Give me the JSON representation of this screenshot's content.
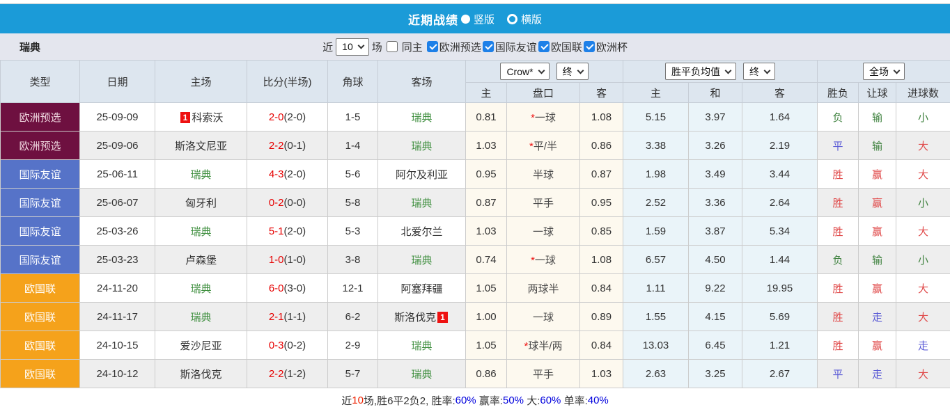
{
  "title_bar": {
    "title": "近期战绩",
    "vertical": {
      "label": "竖版",
      "selected": true
    },
    "horizontal": {
      "label": "横版",
      "selected": false
    }
  },
  "filter_bar": {
    "team": "瑞典",
    "near_label": "近",
    "count_value": "10",
    "matches_label": "场",
    "same_home": {
      "label": "同主",
      "checked": false
    },
    "leagues": [
      {
        "label": "欧洲预选",
        "checked": true
      },
      {
        "label": "国际友谊",
        "checked": true
      },
      {
        "label": "欧国联",
        "checked": true
      },
      {
        "label": "欧洲杯",
        "checked": true
      }
    ]
  },
  "table": {
    "headers": {
      "type": "类型",
      "date": "日期",
      "home": "主场",
      "score": "比分(半场)",
      "corner": "角球",
      "away": "客场",
      "odds_home": "主",
      "handicap": "盘口",
      "odds_away": "客",
      "avg_home": "主",
      "avg_draw": "和",
      "avg_away": "客",
      "result": "胜负",
      "let_goal": "让球",
      "goals": "进球数"
    },
    "selects": {
      "company": "Crow*",
      "company_time": "终",
      "avg": "胜平负均值",
      "avg_time": "终",
      "scope": "全场"
    },
    "highlight_team": "瑞典",
    "type_styles": {
      "欧洲预选": {
        "bg": "#6e1040",
        "fg": "#f0d8e0"
      },
      "国际友谊": {
        "bg": "#5673c8",
        "fg": "#ffffff"
      },
      "欧国联": {
        "bg": "#f5a21b",
        "fg": "#ffffff"
      }
    },
    "word_colors": {
      "胜": "word_red",
      "平": "word_blue",
      "负": "word_green",
      "赢": "word_red",
      "输": "word_green",
      "走": "word_blue",
      "大": "word_red",
      "小": "word_green"
    },
    "rows": [
      {
        "type": "欧洲预选",
        "date": "25-09-09",
        "home": {
          "badge_pre": "1",
          "name": "科索沃"
        },
        "score": {
          "ft": "2-0",
          "ht": "(2-0)"
        },
        "corner": "1-5",
        "away": {
          "name": "瑞典"
        },
        "odds": {
          "home": "0.81",
          "handicap": {
            "star": true,
            "text": "一球"
          },
          "away": "1.08"
        },
        "avg": {
          "home": "5.15",
          "draw": "3.97",
          "away": "1.64"
        },
        "result": "负",
        "let_goal": "输",
        "goals": "小"
      },
      {
        "type": "欧洲预选",
        "date": "25-09-06",
        "home": {
          "name": "斯洛文尼亚"
        },
        "score": {
          "ft": "2-2",
          "ht": "(0-1)"
        },
        "corner": "1-4",
        "away": {
          "name": "瑞典"
        },
        "odds": {
          "home": "1.03",
          "handicap": {
            "star": true,
            "text": "平/半"
          },
          "away": "0.86"
        },
        "avg": {
          "home": "3.38",
          "draw": "3.26",
          "away": "2.19"
        },
        "result": "平",
        "let_goal": "输",
        "goals": "大"
      },
      {
        "type": "国际友谊",
        "date": "25-06-11",
        "home": {
          "name": "瑞典"
        },
        "score": {
          "ft": "4-3",
          "ht": "(2-0)"
        },
        "corner": "5-6",
        "away": {
          "name": "阿尔及利亚"
        },
        "odds": {
          "home": "0.95",
          "handicap": {
            "star": false,
            "text": "半球"
          },
          "away": "0.87"
        },
        "avg": {
          "home": "1.98",
          "draw": "3.49",
          "away": "3.44"
        },
        "result": "胜",
        "let_goal": "赢",
        "goals": "大"
      },
      {
        "type": "国际友谊",
        "date": "25-06-07",
        "home": {
          "name": "匈牙利"
        },
        "score": {
          "ft": "0-2",
          "ht": "(0-0)"
        },
        "corner": "5-8",
        "away": {
          "name": "瑞典"
        },
        "odds": {
          "home": "0.87",
          "handicap": {
            "star": false,
            "text": "平手"
          },
          "away": "0.95"
        },
        "avg": {
          "home": "2.52",
          "draw": "3.36",
          "away": "2.64"
        },
        "result": "胜",
        "let_goal": "赢",
        "goals": "小"
      },
      {
        "type": "国际友谊",
        "date": "25-03-26",
        "home": {
          "name": "瑞典"
        },
        "score": {
          "ft": "5-1",
          "ht": "(2-0)"
        },
        "corner": "5-3",
        "away": {
          "name": "北爱尔兰"
        },
        "odds": {
          "home": "1.03",
          "handicap": {
            "star": false,
            "text": "一球"
          },
          "away": "0.85"
        },
        "avg": {
          "home": "1.59",
          "draw": "3.87",
          "away": "5.34"
        },
        "result": "胜",
        "let_goal": "赢",
        "goals": "大"
      },
      {
        "type": "国际友谊",
        "date": "25-03-23",
        "home": {
          "name": "卢森堡"
        },
        "score": {
          "ft": "1-0",
          "ht": "(1-0)"
        },
        "corner": "3-8",
        "away": {
          "name": "瑞典"
        },
        "odds": {
          "home": "0.74",
          "handicap": {
            "star": true,
            "text": "一球"
          },
          "away": "1.08"
        },
        "avg": {
          "home": "6.57",
          "draw": "4.50",
          "away": "1.44"
        },
        "result": "负",
        "let_goal": "输",
        "goals": "小"
      },
      {
        "type": "欧国联",
        "date": "24-11-20",
        "home": {
          "name": "瑞典"
        },
        "score": {
          "ft": "6-0",
          "ht": "(3-0)"
        },
        "corner": "12-1",
        "away": {
          "name": "阿塞拜疆"
        },
        "odds": {
          "home": "1.05",
          "handicap": {
            "star": false,
            "text": "两球半"
          },
          "away": "0.84"
        },
        "avg": {
          "home": "1.11",
          "draw": "9.22",
          "away": "19.95"
        },
        "result": "胜",
        "let_goal": "赢",
        "goals": "大"
      },
      {
        "type": "欧国联",
        "date": "24-11-17",
        "home": {
          "name": "瑞典"
        },
        "score": {
          "ft": "2-1",
          "ht": "(1-1)"
        },
        "corner": "6-2",
        "away": {
          "name": "斯洛伐克",
          "badge_post": "1"
        },
        "odds": {
          "home": "1.00",
          "handicap": {
            "star": false,
            "text": "一球"
          },
          "away": "0.89"
        },
        "avg": {
          "home": "1.55",
          "draw": "4.15",
          "away": "5.69"
        },
        "result": "胜",
        "let_goal": "走",
        "goals": "大"
      },
      {
        "type": "欧国联",
        "date": "24-10-15",
        "home": {
          "name": "爱沙尼亚"
        },
        "score": {
          "ft": "0-3",
          "ht": "(0-2)"
        },
        "corner": "2-9",
        "away": {
          "name": "瑞典"
        },
        "odds": {
          "home": "1.05",
          "handicap": {
            "star": true,
            "text": "球半/两"
          },
          "away": "0.84"
        },
        "avg": {
          "home": "13.03",
          "draw": "6.45",
          "away": "1.21"
        },
        "result": "胜",
        "let_goal": "赢",
        "goals": "走"
      },
      {
        "type": "欧国联",
        "date": "24-10-12",
        "home": {
          "name": "斯洛伐克"
        },
        "score": {
          "ft": "2-2",
          "ht": "(1-2)"
        },
        "corner": "5-7",
        "away": {
          "name": "瑞典"
        },
        "odds": {
          "home": "0.86",
          "handicap": {
            "star": false,
            "text": "平手"
          },
          "away": "1.03"
        },
        "avg": {
          "home": "2.63",
          "draw": "3.25",
          "away": "2.67"
        },
        "result": "平",
        "let_goal": "走",
        "goals": "大"
      }
    ]
  },
  "summary": {
    "segments": [
      {
        "t": "近",
        "c": "#333333"
      },
      {
        "t": "10",
        "c": "#ee2200"
      },
      {
        "t": "场,胜6平2负2, 胜率:",
        "c": "#333333"
      },
      {
        "t": "60%",
        "c": "#0000dd"
      },
      {
        "t": " 赢率:",
        "c": "#333333"
      },
      {
        "t": "50%",
        "c": "#0000dd"
      },
      {
        "t": " 大:",
        "c": "#333333"
      },
      {
        "t": "60%",
        "c": "#0000dd"
      },
      {
        "t": " 单率:",
        "c": "#333333"
      },
      {
        "t": "40%",
        "c": "#0000dd"
      }
    ]
  },
  "colors": {
    "topbar_blue": "#1b9bd8",
    "score_red": "#e60000",
    "star_red": "#ee1111",
    "team_green": "#3f8f3f",
    "plain_text": "#333333",
    "handicap_text": "#4a4a4a",
    "word_red": "#e04a4a",
    "word_green": "#3f823f",
    "word_blue": "#5b5bd6",
    "badge_red": "#ee1111",
    "cream_bg": "#fdf9ef",
    "lightblue_bg": "#eaf4f9",
    "even_row_bg": "#eeeeee"
  }
}
